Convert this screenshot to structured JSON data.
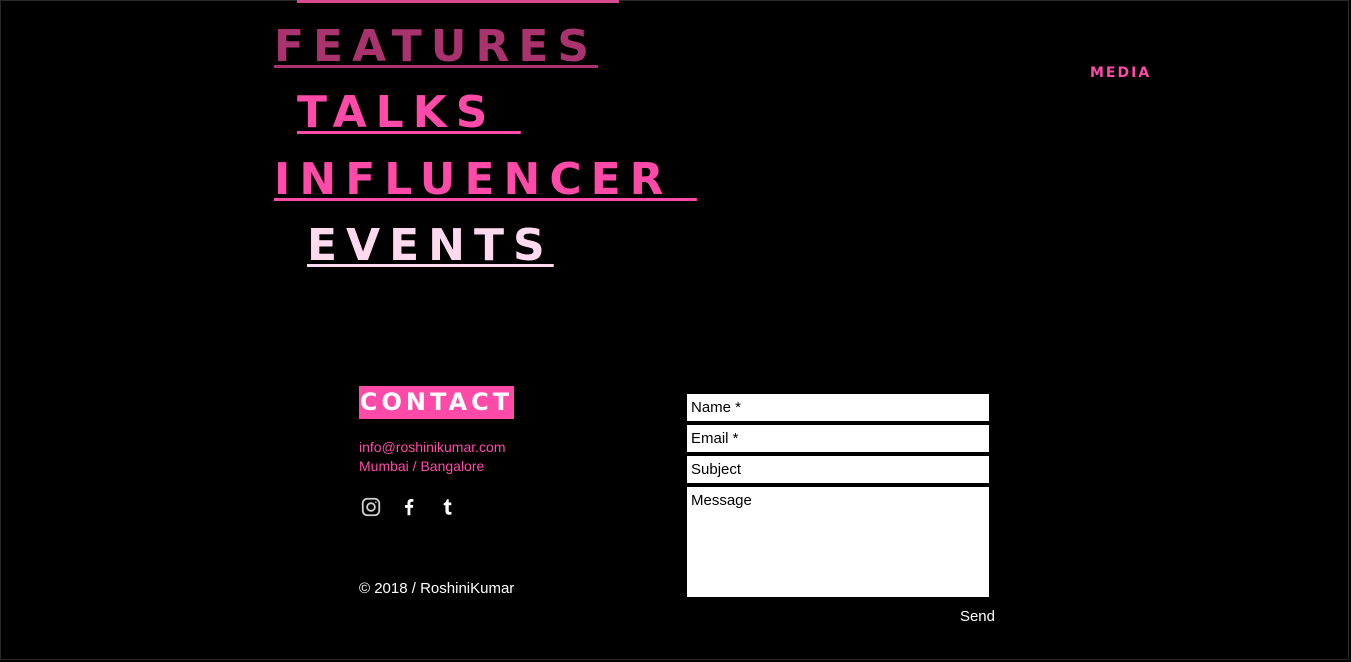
{
  "nav": {
    "features": "FEATURES",
    "talks": "TALKS ",
    "influencer": "INFLUENCER ",
    "events": "EVENTS",
    "media": "MEDIA"
  },
  "contact": {
    "heading": "CONTACT",
    "email": "info@roshinikumar.com",
    "location": "Mumbai / Bangalore"
  },
  "social": [
    {
      "icon": "instagram-icon"
    },
    {
      "icon": "facebook-icon"
    },
    {
      "icon": "tumblr-icon"
    }
  ],
  "footer": {
    "copyright": "© 2018 / RoshiniKumar"
  },
  "form": {
    "name_placeholder": "Name *",
    "email_placeholder": "Email *",
    "subject_placeholder": "Subject",
    "message_placeholder": "Message",
    "send_label": "Send"
  },
  "colors": {
    "background": "#000000",
    "accent_pink": "#ff4aa8",
    "muted_pink": "#a8336d",
    "light_pink": "#ffd9ee"
  }
}
